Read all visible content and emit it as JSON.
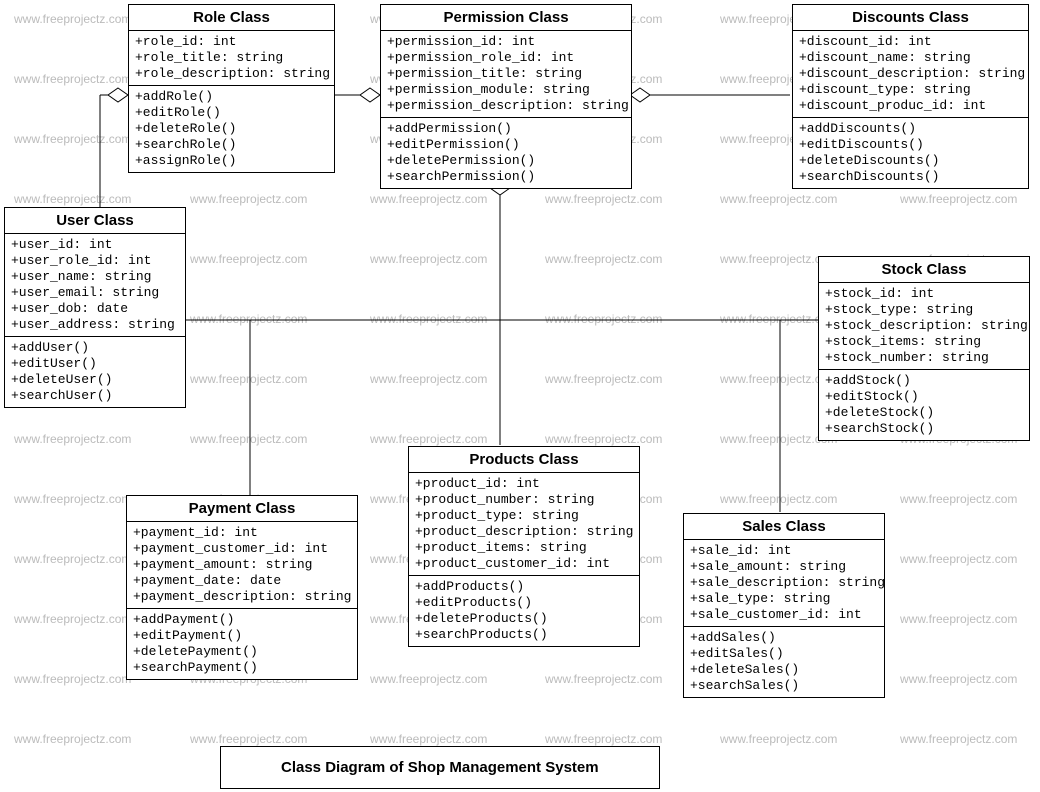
{
  "watermark_text": "www.freeprojectz.com",
  "diagram_title": "Class Diagram of Shop Management System",
  "classes": {
    "role": {
      "name": "Role Class",
      "attrs": [
        "+role_id: int",
        "+role_title: string",
        "+role_description: string"
      ],
      "ops": [
        "+addRole()",
        "+editRole()",
        "+deleteRole()",
        "+searchRole()",
        "+assignRole()"
      ]
    },
    "permission": {
      "name": "Permission Class",
      "attrs": [
        "+permission_id: int",
        "+permission_role_id: int",
        "+permission_title: string",
        "+permission_module: string",
        "+permission_description: string"
      ],
      "ops": [
        "+addPermission()",
        "+editPermission()",
        "+deletePermission()",
        "+searchPermission()"
      ]
    },
    "discounts": {
      "name": "Discounts Class",
      "attrs": [
        "+discount_id: int",
        "+discount_name: string",
        "+discount_description: string",
        "+discount_type: string",
        "+discount_produc_id: int"
      ],
      "ops": [
        "+addDiscounts()",
        "+editDiscounts()",
        "+deleteDiscounts()",
        "+searchDiscounts()"
      ]
    },
    "user": {
      "name": "User Class",
      "attrs": [
        "+user_id: int",
        "+user_role_id: int",
        "+user_name: string",
        "+user_email: string",
        "+user_dob: date",
        "+user_address: string"
      ],
      "ops": [
        "+addUser()",
        "+editUser()",
        "+deleteUser()",
        "+searchUser()"
      ]
    },
    "stock": {
      "name": "Stock Class",
      "attrs": [
        "+stock_id: int",
        "+stock_type: string",
        "+stock_description: string",
        "+stock_items: string",
        "+stock_number: string"
      ],
      "ops": [
        "+addStock()",
        "+editStock()",
        "+deleteStock()",
        "+searchStock()"
      ]
    },
    "payment": {
      "name": "Payment Class",
      "attrs": [
        "+payment_id: int",
        "+payment_customer_id: int",
        "+payment_amount: string",
        "+payment_date: date",
        "+payment_description: string"
      ],
      "ops": [
        "+addPayment()",
        "+editPayment()",
        "+deletePayment()",
        "+searchPayment()"
      ]
    },
    "products": {
      "name": "Products  Class",
      "attrs": [
        "+product_id: int",
        "+product_number: string",
        "+product_type: string",
        "+product_description: string",
        "+product_items: string",
        "+product_customer_id: int"
      ],
      "ops": [
        "+addProducts()",
        "+editProducts()",
        "+deleteProducts()",
        "+searchProducts()"
      ]
    },
    "sales": {
      "name": "Sales Class",
      "attrs": [
        "+sale_id: int",
        "+sale_amount: string",
        "+sale_description: string",
        "+sale_type: string",
        "+sale_customer_id: int"
      ],
      "ops": [
        "+addSales()",
        "+editSales()",
        "+deleteSales()",
        "+searchSales()"
      ]
    }
  }
}
